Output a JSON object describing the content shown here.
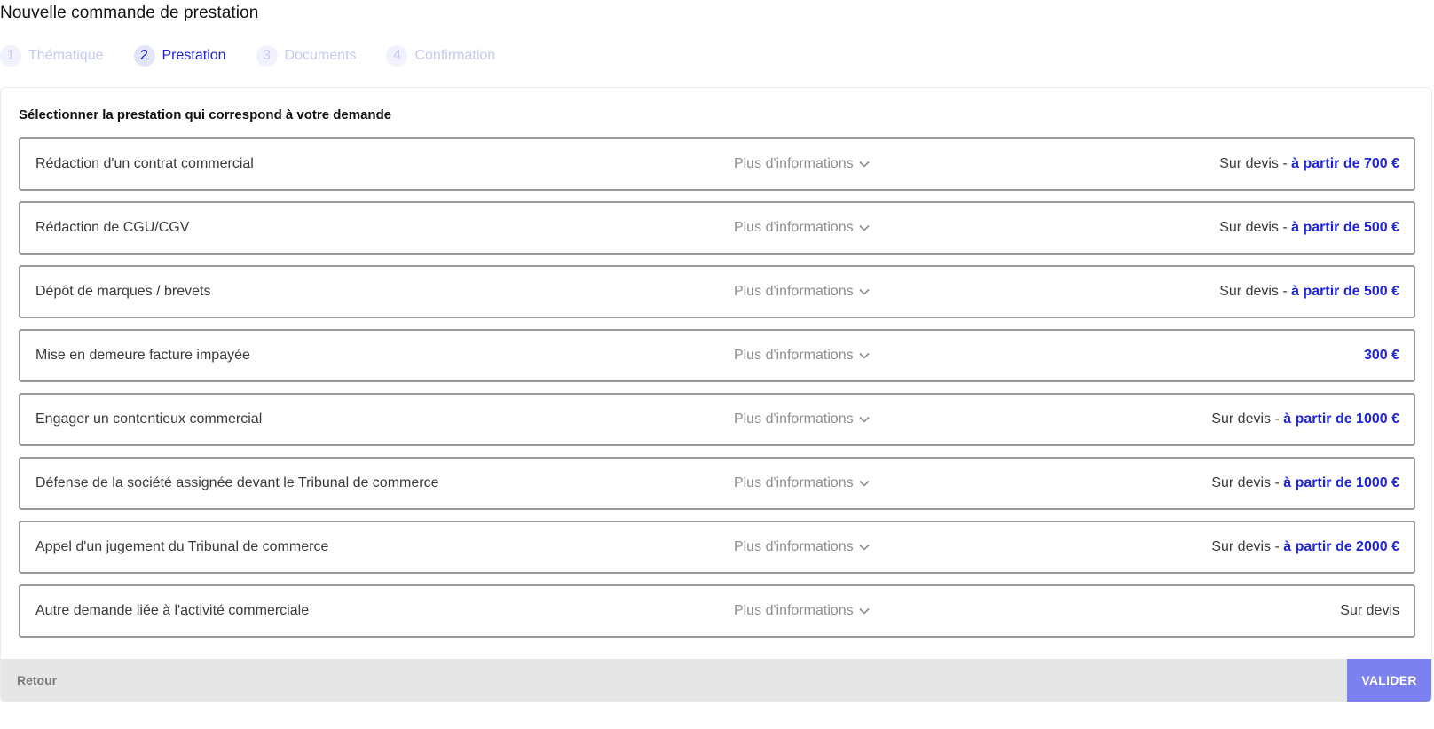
{
  "page": {
    "title": "Nouvelle commande de prestation"
  },
  "stepper": {
    "steps": [
      {
        "number": "1",
        "label": "Thématique",
        "state": "inactive"
      },
      {
        "number": "2",
        "label": "Prestation",
        "state": "active"
      },
      {
        "number": "3",
        "label": "Documents",
        "state": "inactive"
      },
      {
        "number": "4",
        "label": "Confirmation",
        "state": "inactive"
      }
    ]
  },
  "main": {
    "section_title": "Sélectionner la prestation qui correspond à votre demande",
    "more_info_label": "Plus d'informations",
    "more_info_icon": "chevron-down-icon",
    "options": [
      {
        "name": "Rédaction d'un contrat commercial",
        "price_prefix": "Sur devis - ",
        "price_amount": "à partir de 700 €"
      },
      {
        "name": "Rédaction de CGU/CGV",
        "price_prefix": "Sur devis - ",
        "price_amount": "à partir de 500 €"
      },
      {
        "name": "Dépôt de marques / brevets",
        "price_prefix": "Sur devis - ",
        "price_amount": "à partir de 500 €"
      },
      {
        "name": "Mise en demeure facture impayée",
        "price_prefix": "",
        "price_amount": "300 €"
      },
      {
        "name": "Engager un contentieux commercial",
        "price_prefix": "Sur devis - ",
        "price_amount": "à partir de 1000 €"
      },
      {
        "name": "Défense de la société assignée devant le Tribunal de commerce",
        "price_prefix": "Sur devis - ",
        "price_amount": "à partir de 1000 €"
      },
      {
        "name": "Appel d'un jugement du Tribunal de commerce",
        "price_prefix": "Sur devis - ",
        "price_amount": "à partir de 2000 €"
      },
      {
        "name": "Autre demande liée à l'activité commerciale",
        "price_prefix": "Sur devis",
        "price_amount": ""
      }
    ]
  },
  "footer": {
    "back_label": "Retour",
    "validate_label": "VALIDER"
  },
  "colors": {
    "accent": "#1f24d6",
    "step_inactive": "#c6c9f3",
    "validate_button": "#7b82f0",
    "footer_bg": "#e6e6e6",
    "option_border": "#9a9a9a"
  }
}
